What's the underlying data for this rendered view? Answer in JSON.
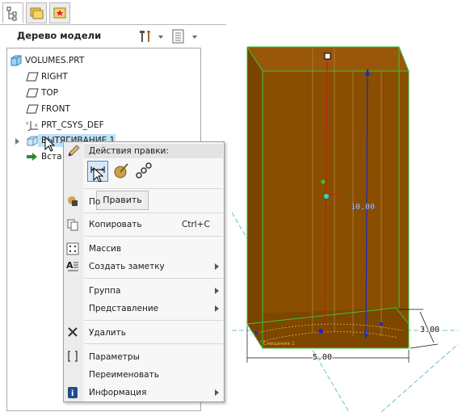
{
  "tree": {
    "title": "Дерево модели",
    "items": [
      {
        "label": "VOLUMES.PRT"
      },
      {
        "label": "RIGHT"
      },
      {
        "label": "TOP"
      },
      {
        "label": "FRONT"
      },
      {
        "label": "PRT_CSYS_DEF"
      },
      {
        "label": "ВЫТЯГИВАНИЕ 1"
      },
      {
        "label": "Вста"
      }
    ]
  },
  "menu": {
    "header": "Действия правки:",
    "tooltip": "Править",
    "items": {
      "po": "По",
      "copy": "Копировать",
      "copy_shortcut": "Ctrl+C",
      "array": "Массив",
      "note": "Создать заметку",
      "group": "Группа",
      "view": "Представление",
      "delete": "Удалить",
      "params": "Параметры",
      "rename": "Переименовать",
      "info": "Информация"
    }
  },
  "viewport": {
    "dim_height": "10.00",
    "dim_width": "5.00",
    "dim_depth": "3.00",
    "sketch_label": "Смещение 1"
  },
  "colors": {
    "solid": "#8a4e00",
    "edge": "#39c43a",
    "highlight": "#bfe1f7"
  }
}
